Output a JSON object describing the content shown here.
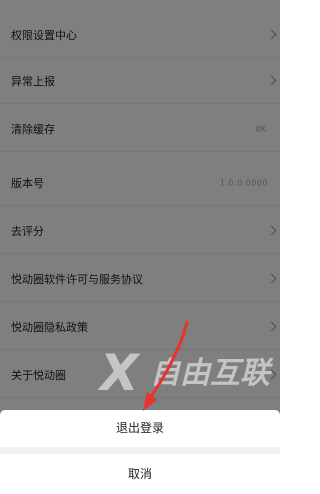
{
  "settings": {
    "rows": [
      {
        "label": "权限设置中心"
      },
      {
        "label": "异常上报"
      },
      {
        "label": "清除缓存",
        "value": "0K"
      },
      {
        "label": "版本号",
        "value": "1.0.0.0000"
      },
      {
        "label": "去评分"
      },
      {
        "label": "悦动圈软件许可与服务协议"
      },
      {
        "label": "悦动圈隐私政策"
      },
      {
        "label": "关于悦动圈"
      }
    ]
  },
  "action_sheet": {
    "logout_label": "退出登录",
    "cancel_label": "取消"
  },
  "watermark": {
    "text": "自由互联",
    "logo_letter": "X"
  },
  "colors": {
    "overlay": "rgba(0,0,0,0.5)",
    "annotation_arrow": "#e8322b"
  }
}
